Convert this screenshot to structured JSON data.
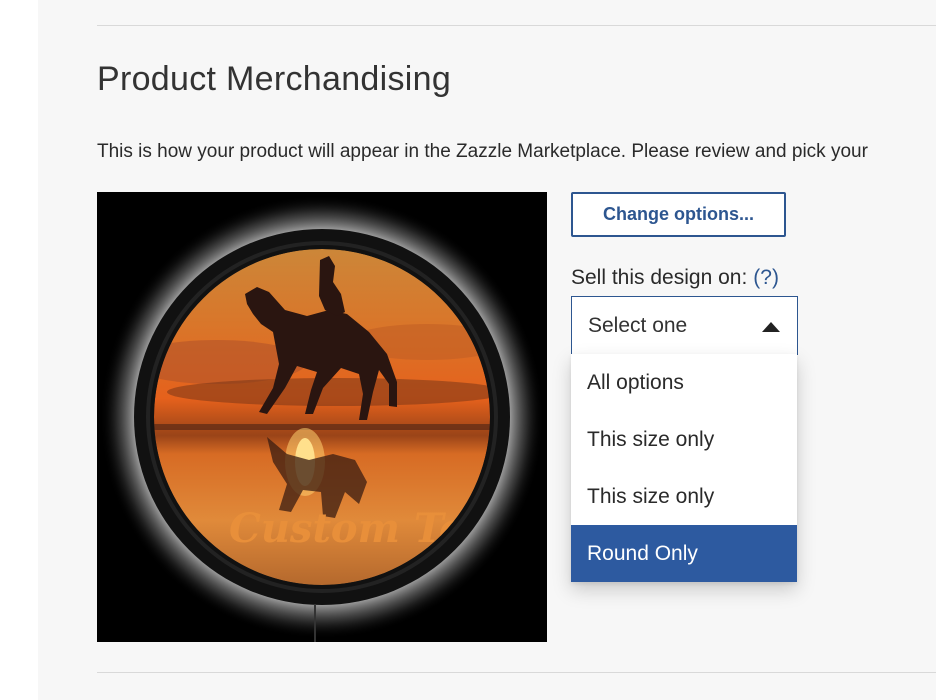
{
  "page": {
    "title": "Product Merchandising",
    "description": "This is how your product will appear in the Zazzle Marketplace. Please review and pick your"
  },
  "preview": {
    "overlay_text": "Custom Text"
  },
  "actions": {
    "change_options_label": "Change options..."
  },
  "sell": {
    "label": "Sell this design on:",
    "help_link": "(?)",
    "select_value": "Select one",
    "options": [
      {
        "label": "All options",
        "selected": false
      },
      {
        "label": "This size only",
        "selected": false
      },
      {
        "label": "This size only",
        "selected": false
      },
      {
        "label": "Round Only",
        "selected": true
      }
    ]
  },
  "colors": {
    "accent": "#2d5690",
    "selected_bg": "#2d5aa0",
    "panel_bg": "#f7f7f7"
  }
}
